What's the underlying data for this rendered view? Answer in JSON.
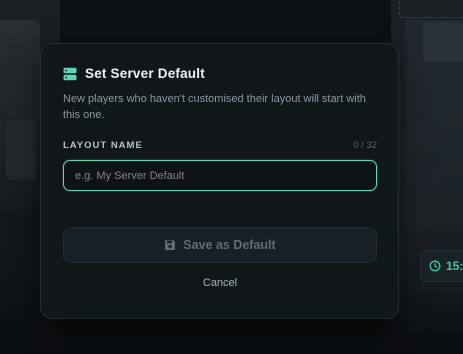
{
  "background": {
    "time_text": "15:"
  },
  "dialog": {
    "icon": "server-icon",
    "title": "Set Server Default",
    "description": "New players who haven't customised their layout will start with this one.",
    "field_label": "LAYOUT NAME",
    "char_count": "0 / 32",
    "input_value": "",
    "input_placeholder": "e.g. My Server Default",
    "save_label": "Save as Default",
    "save_icon": "floppy-disk-icon",
    "cancel_label": "Cancel"
  },
  "colors": {
    "accent": "#5fd6b7",
    "surface": "#111619",
    "save_disabled_text": "#5e6d73"
  }
}
